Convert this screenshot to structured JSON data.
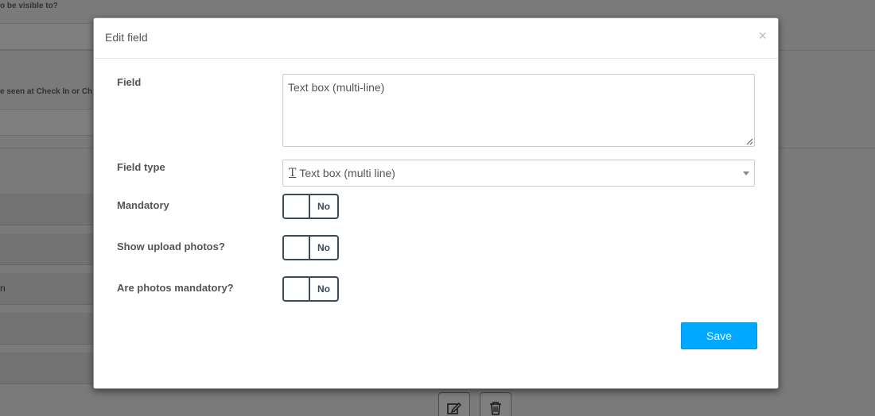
{
  "background": {
    "label_visible_to": "o be visible to?",
    "label_seen_at": "e seen at Check In or Ch",
    "row_text": "n"
  },
  "modal": {
    "title": "Edit field",
    "close_glyph": "×",
    "fields": {
      "field_label": "Field",
      "field_value": "Text box (multi-line)",
      "type_label": "Field type",
      "type_icon": "T",
      "type_value": "Text box (multi line)"
    },
    "toggles": [
      {
        "label": "Mandatory",
        "state": "No"
      },
      {
        "label": "Show upload photos?",
        "state": "No"
      },
      {
        "label": "Are photos mandatory?",
        "state": "No"
      }
    ],
    "save_label": "Save"
  },
  "colors": {
    "accent": "#00a8ff",
    "toggle_border": "#3c4a5a"
  }
}
